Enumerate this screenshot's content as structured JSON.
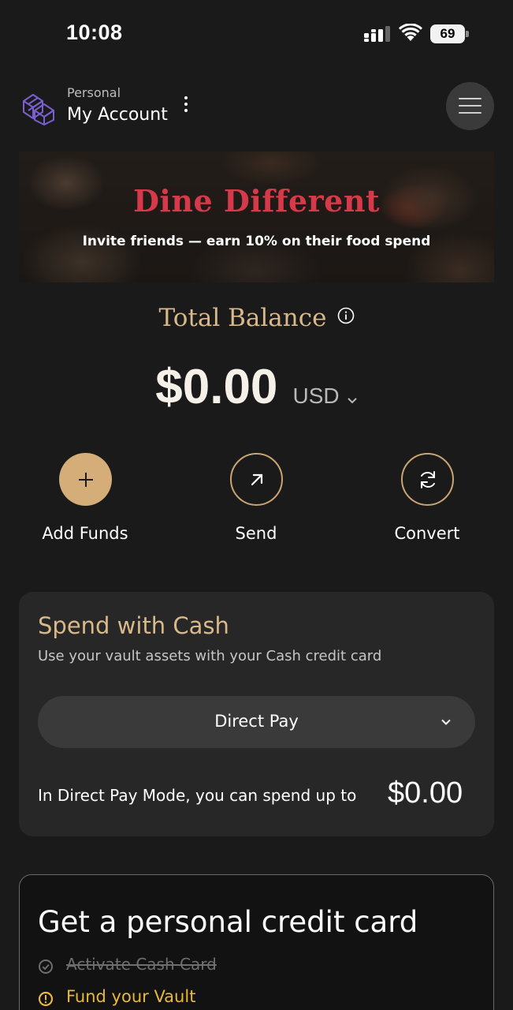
{
  "status_bar": {
    "time": "10:08",
    "battery": "69",
    "icons": [
      "signal-icon",
      "wifi-icon",
      "battery-icon"
    ]
  },
  "header": {
    "account_type": "Personal",
    "account_name": "My Account",
    "icons": [
      "logo-icon",
      "more-vertical-icon",
      "menu-icon"
    ]
  },
  "banner": {
    "title": "Dine Different",
    "subtitle": "Invite friends — earn 10% on their food spend"
  },
  "balance": {
    "label": "Total Balance",
    "amount": "$0.00",
    "currency": "USD"
  },
  "actions": [
    {
      "label": "Add Funds",
      "icon": "plus-icon"
    },
    {
      "label": "Send",
      "icon": "arrow-up-right-icon"
    },
    {
      "label": "Convert",
      "icon": "refresh-icon"
    }
  ],
  "spend": {
    "title": "Spend with Cash",
    "subtitle": "Use your vault assets with your Cash credit card",
    "mode": "Direct Pay",
    "limit_text": "In Direct Pay Mode, you can spend up to",
    "limit_amount": "$0.00"
  },
  "credit_card": {
    "title": "Get a personal credit card",
    "steps": [
      {
        "label": "Activate Cash Card",
        "state": "done"
      },
      {
        "label": "Fund your Vault",
        "state": "pending"
      }
    ]
  },
  "colors": {
    "background": "#1a1a1a",
    "gold": "#d4ad78",
    "gold_text": "#d9b98a",
    "banner_red": "#d6394a",
    "warning_yellow": "#e8b83d"
  }
}
